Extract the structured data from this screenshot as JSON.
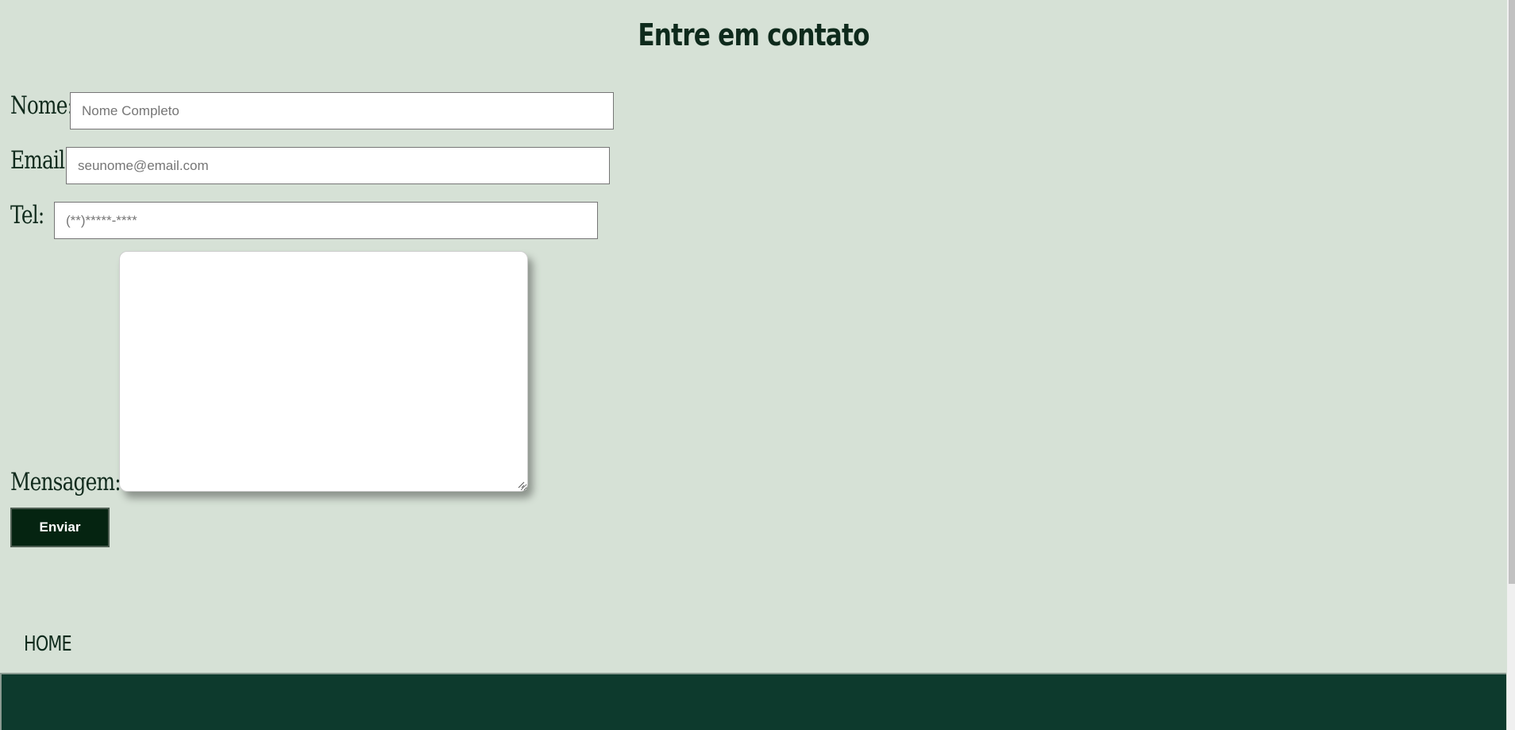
{
  "header": {
    "title": "Entre em contato"
  },
  "form": {
    "name_label": "Nome:",
    "name_placeholder": "Nome Completo",
    "email_label": "Email:",
    "email_placeholder": "seunome@email.com",
    "tel_label": "Tel:",
    "tel_placeholder": "(**)*****-****",
    "message_label": "Mensagem:",
    "message_value": "",
    "submit_label": "Enviar"
  },
  "nav": {
    "home_label": "HOME"
  },
  "colors": {
    "background": "#d6e1d6",
    "text_dark": "#0e2a1c",
    "button_bg": "#052411",
    "footer_bg": "#0d3a2d"
  }
}
